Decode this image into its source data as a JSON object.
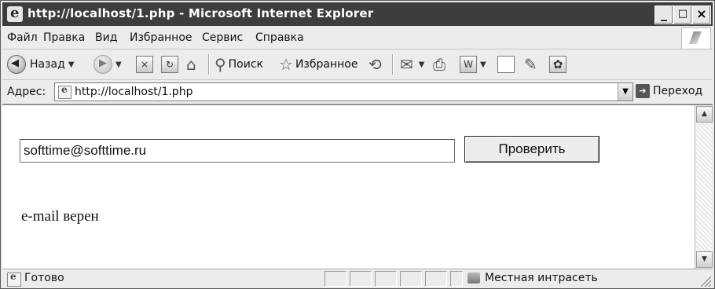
{
  "window": {
    "title": "http://localhost/1.php - Microsoft Internet Explorer",
    "minimize": "_",
    "maximize": "□",
    "close": "×"
  },
  "menu": {
    "items": [
      "Файл",
      "Правка",
      "Вид",
      "Избранное",
      "Сервис",
      "Справка"
    ]
  },
  "toolbar": {
    "back_label": "Назад",
    "search_label": "Поиск",
    "favorites_label": "Избранное"
  },
  "address": {
    "label": "Адрес:",
    "url": "http://localhost/1.php",
    "go_label": "Переход"
  },
  "page": {
    "email_value": "softtime@softtime.ru",
    "check_button": "Проверить",
    "result_text": "e-mail верен"
  },
  "status": {
    "text": "Готово",
    "zone": "Местная интрасеть"
  }
}
